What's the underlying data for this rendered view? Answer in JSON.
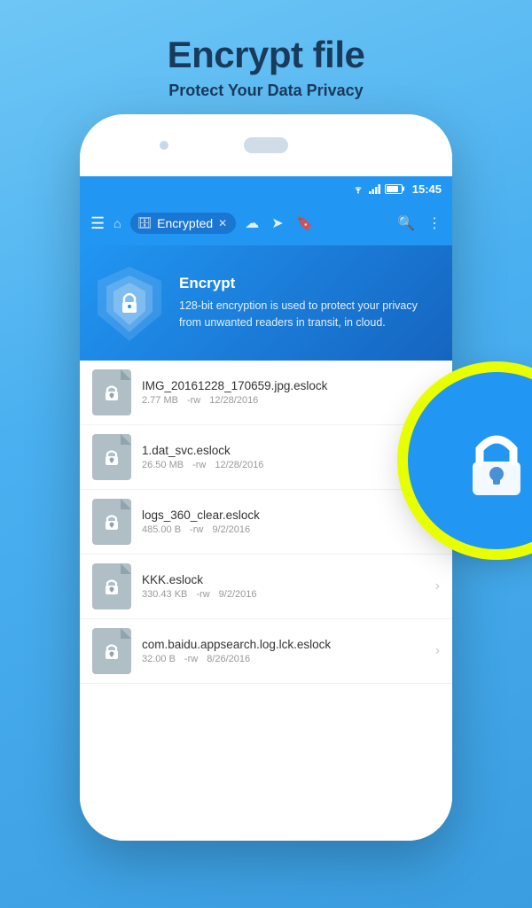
{
  "header": {
    "title": "Encrypt file",
    "subtitle": "Protect Your Data Privacy"
  },
  "status_bar": {
    "time": "15:45"
  },
  "toolbar": {
    "breadcrumb_label": "Encrypted",
    "home_label": "Home"
  },
  "banner": {
    "title": "Encrypt",
    "description": "128-bit encryption is used to protect your privacy from unwanted readers in transit, in cloud."
  },
  "files": [
    {
      "name": "IMG_20161228_170659.jpg.eslock",
      "size": "2.77 MB",
      "permissions": "-rw",
      "date": "12/28/2016"
    },
    {
      "name": "1.dat_svc.eslock",
      "size": "26.50 MB",
      "permissions": "-rw",
      "date": "12/28/2016"
    },
    {
      "name": "logs_360_clear.eslock",
      "size": "485.00 B",
      "permissions": "-rw",
      "date": "9/2/2016"
    },
    {
      "name": "KKK.eslock",
      "size": "330.43 KB",
      "permissions": "-rw",
      "date": "9/2/2016"
    },
    {
      "name": "com.baidu.appsearch.log.lck.eslock",
      "size": "32.00 B",
      "permissions": "-rw",
      "date": "8/26/2016"
    }
  ]
}
